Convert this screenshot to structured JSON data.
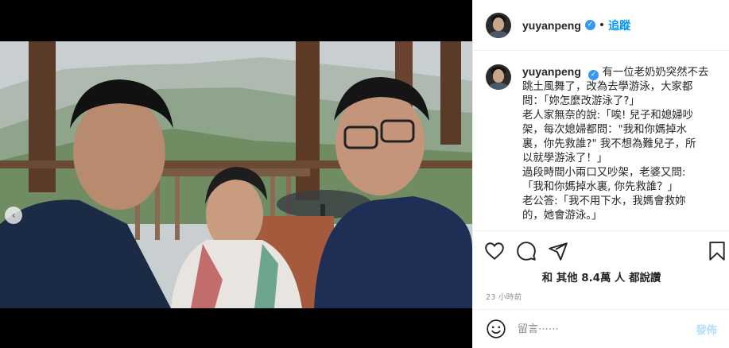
{
  "post": {
    "username": "yuyanpeng",
    "follow_label": "追蹤",
    "header_separator": "•",
    "more_icon": "more-icon",
    "caption_lines": [
      "有一位老奶奶突然不去",
      "跳土風舞了，改為去學游泳，大家都",
      "問：「妳怎麼改游泳了?」",
      "老人家無奈的說:「唉! 兒子和媳婦吵",
      "架，每次媳婦都問：\"我和你媽掉水",
      "裏，你先救誰?\" 我不想為難兒子，所",
      "以就學游泳了！」",
      "過段時間小兩口又吵架，老婆又問:",
      "「我和你媽掉水裏, 你先救誰？」",
      "老公答:「我不用下水，我媽會救妳",
      "的，她會游泳。」"
    ],
    "likes_text": "和 其他 8.4萬 人 都說讚",
    "time_ago": "23 小時前",
    "comment_placeholder": "留言⋯⋯",
    "post_button": "發佈",
    "carousel_prev_glyph": "‹"
  },
  "icons": [
    "heart-icon",
    "comment-icon",
    "share-icon",
    "bookmark-icon",
    "emoji-icon",
    "verified-badge-icon"
  ],
  "colors": {
    "accent": "#0095f6",
    "post_disabled": "#b2dffc",
    "verified": "#3897f0",
    "text": "#262626",
    "muted": "#8e8e8e"
  }
}
